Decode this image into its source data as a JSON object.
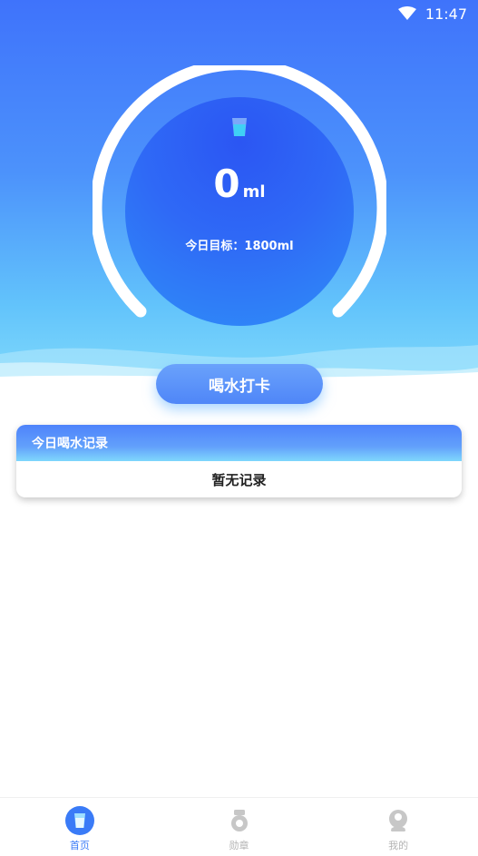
{
  "status_bar": {
    "time": "11:47"
  },
  "intake": {
    "amount": "0",
    "unit": "ml",
    "goal_text": "今日目标：1800ml"
  },
  "checkin_button": {
    "label": "喝水打卡"
  },
  "records": {
    "title": "今日喝水记录",
    "empty_text": "暂无记录"
  },
  "bottom_nav": {
    "items": [
      {
        "label": "首页",
        "icon": "cup-icon",
        "active": true
      },
      {
        "label": "勋章",
        "icon": "medal-icon",
        "active": false
      },
      {
        "label": "我的",
        "icon": "profile-icon",
        "active": false
      }
    ]
  },
  "colors": {
    "primary": "#3a7bf7",
    "hero_top": "#3f73fb",
    "hero_bottom": "#7fd9fb",
    "inactive": "#b4b4b4"
  }
}
